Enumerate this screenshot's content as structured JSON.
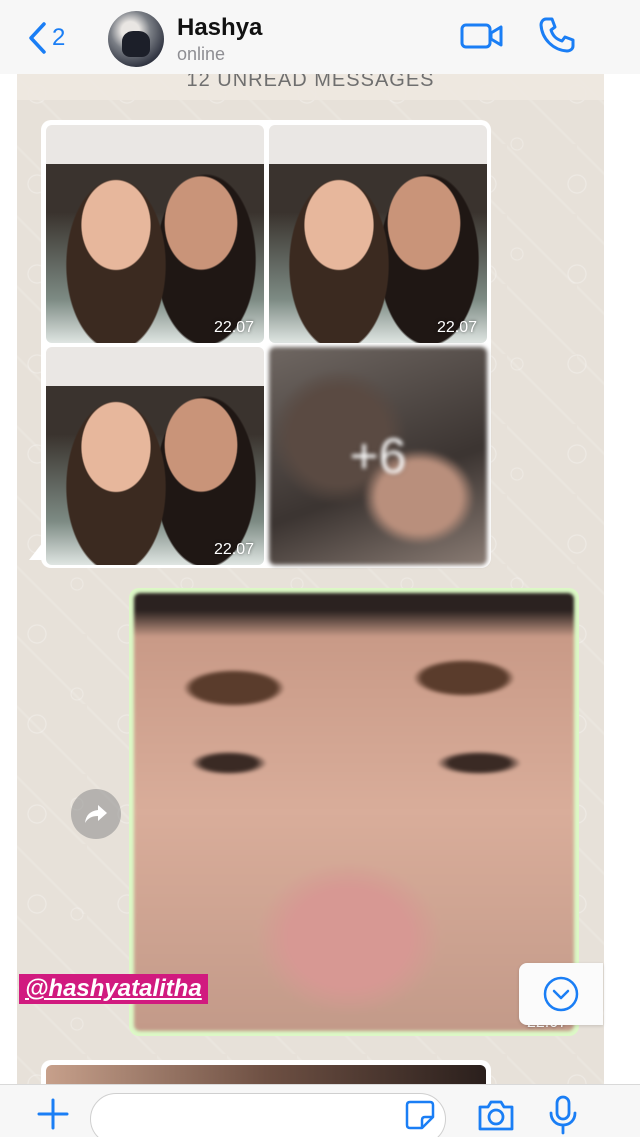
{
  "header": {
    "back_count": "2",
    "contact_name": "Hashya",
    "contact_status": "online",
    "icons": [
      "chevron-left-icon",
      "video-call-icon",
      "phone-icon"
    ]
  },
  "chat": {
    "unread_banner": "12 UNREAD MESSAGES",
    "album": {
      "photos": [
        {
          "time": "22.07"
        },
        {
          "time": "22.07"
        },
        {
          "time": "22.07"
        }
      ],
      "more_count": "+6"
    },
    "outgoing_photo": {
      "time": "22.07"
    },
    "overlay_tag": "@hashyatalitha"
  },
  "composer": {
    "input_value": "",
    "icons": [
      "plus-icon",
      "sticker-icon",
      "camera-icon",
      "microphone-icon"
    ]
  },
  "colors": {
    "accent": "#1a7ef5",
    "outgoing_bubble": "#dcf8c6",
    "tag_background": "#d11a7f"
  }
}
